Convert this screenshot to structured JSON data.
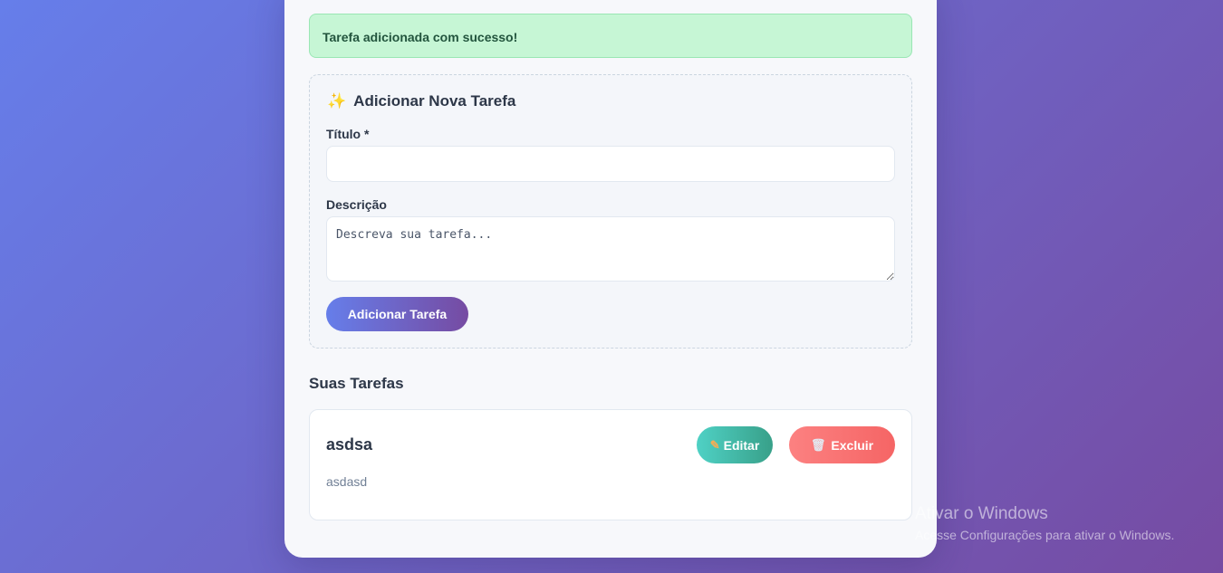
{
  "alert": {
    "message": "Tarefa adicionada com sucesso!"
  },
  "form": {
    "title": "Adicionar Nova Tarefa",
    "title_icon": "sparkles-icon",
    "title_field_label": "Título *",
    "title_field_value": "",
    "description_label": "Descrição",
    "description_placeholder": "Descreva sua tarefa...",
    "submit_label": "Adicionar Tarefa"
  },
  "tasks_section": {
    "title": "Suas Tarefas",
    "tasks": [
      {
        "title": "asdsa",
        "description": "asdasd",
        "edit_label": "Editar",
        "edit_icon": "pencil-icon",
        "delete_label": "Excluir",
        "delete_icon": "trash-icon"
      }
    ]
  },
  "watermark": {
    "title": "Ativar o Windows",
    "subtitle": "Acesse Configurações para ativar o Windows."
  },
  "colors": {
    "background_start": "#667eea",
    "background_end": "#764ba2",
    "success_bg": "#c6f6d5",
    "edit_button": "#38b2ac",
    "delete_button": "#f56565"
  }
}
